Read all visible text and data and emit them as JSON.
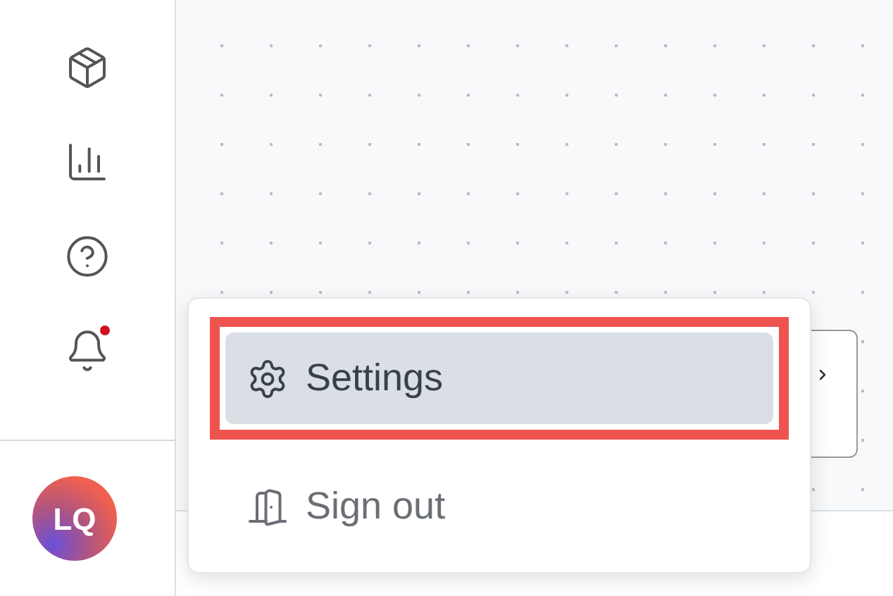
{
  "sidebar": {
    "items": [
      {
        "kind": "package"
      },
      {
        "kind": "chart"
      },
      {
        "kind": "help"
      },
      {
        "kind": "bell",
        "unread": true
      }
    ],
    "avatar": {
      "initials": "LQ"
    }
  },
  "menu": {
    "items": [
      {
        "kind": "settings",
        "label": "Settings",
        "selected": true
      },
      {
        "kind": "signout",
        "label": "Sign out",
        "selected": false
      }
    ]
  }
}
